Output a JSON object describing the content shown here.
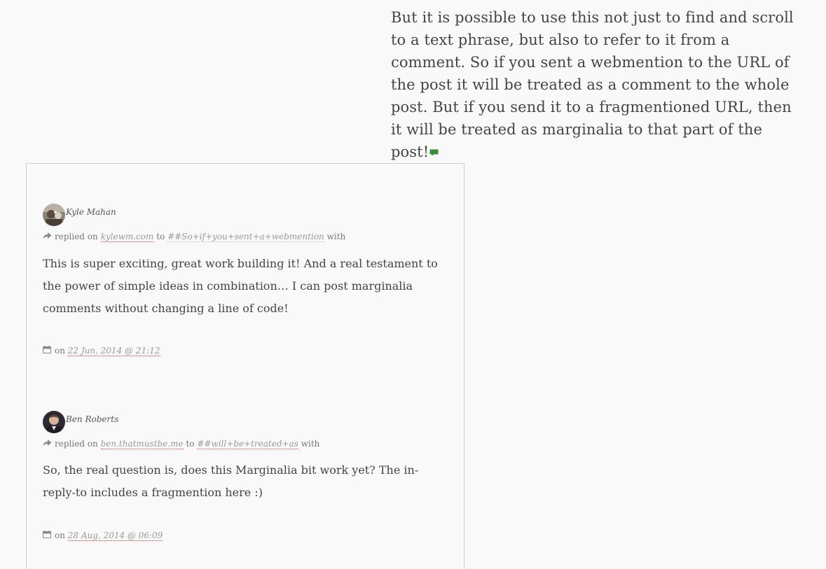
{
  "article": {
    "paragraph": "But it is possible to use this not just to find and scroll to a text phrase, but also to refer to it from a comment. So if you sent a webmention to the URL of the post it will be treated as a comment to the whole post. But if you send it to a fragmentioned URL, then it will be treated as marginalia to that part of the post!",
    "comment_icon": "speech-bubble-icon",
    "accent_color": "#3a8a3a"
  },
  "comments": [
    {
      "author": "Kyle Mahan",
      "action": "replied on",
      "site": "kylewm.com",
      "to_word": "to",
      "fragment": "##So+if+you+sent+a+webmention",
      "with_word": "with",
      "body": "This is super exciting, great work building it! And a real testament to the power of simple ideas in combination… I can post marginalia comments without changing a line of code!",
      "on_word": "on",
      "date": "22 Jun, 2014 @ 21:12"
    },
    {
      "author": "Ben Roberts",
      "action": "replied on",
      "site": "ben.thatmustbe.me",
      "to_word": "to",
      "fragment": "##will+be+treated+as",
      "with_word": "with",
      "body": "So, the real question is, does this Marginalia bit work yet?  The in-reply-to includes a fragmention here :)",
      "on_word": "on",
      "date": "28 Aug, 2014 @ 06:09"
    }
  ]
}
